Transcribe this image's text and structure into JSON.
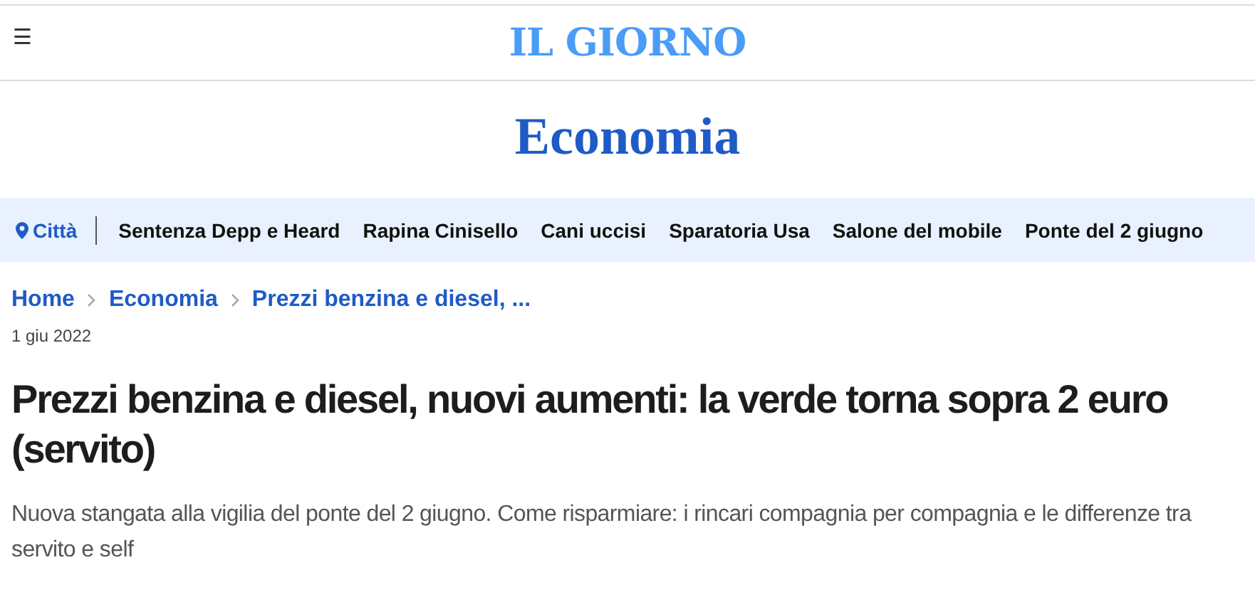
{
  "header": {
    "menu_icon": "☰",
    "logo": "IL GIORNO"
  },
  "section_title": "Economia",
  "nav": {
    "city": "Città",
    "items": [
      "Sentenza Depp e Heard",
      "Rapina Cinisello",
      "Cani uccisi",
      "Sparatoria Usa",
      "Salone del mobile",
      "Ponte del 2 giugno"
    ]
  },
  "breadcrumb": [
    "Home",
    "Economia",
    "Prezzi benzina e diesel, ..."
  ],
  "date": "1 giu 2022",
  "headline": "Prezzi benzina e diesel, nuovi aumenti: la verde torna sopra 2 euro (servito)",
  "subheadline": "Nuova stangata alla vigilia del ponte del 2 giugno. Come risparmiare: i rincari compagnia per compagnia e le differenze tra servito e self"
}
